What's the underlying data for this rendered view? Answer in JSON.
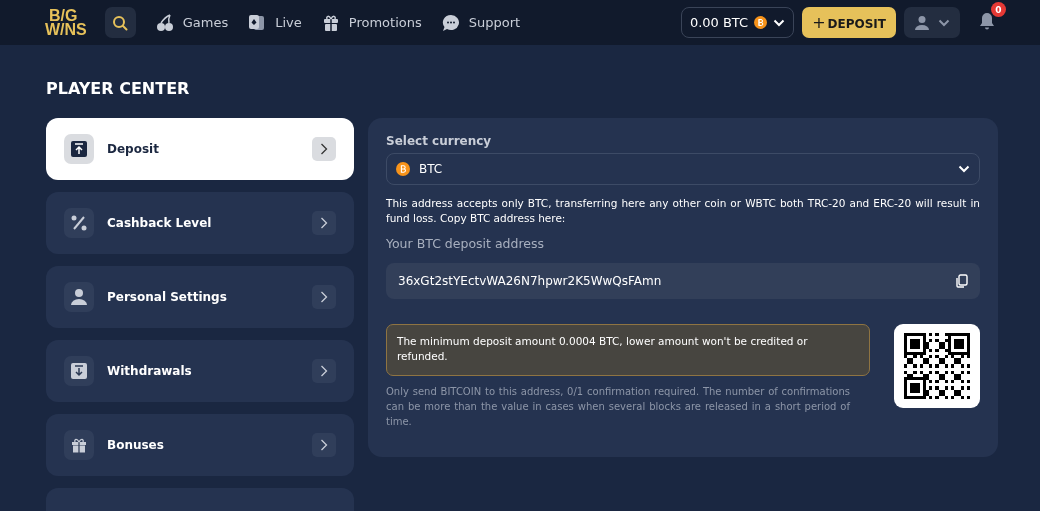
{
  "logo": {
    "line_1": "B/G",
    "line_2": "W/NS"
  },
  "nav": [
    {
      "label": "Games"
    },
    {
      "label": "Live"
    },
    {
      "label": "Promotions"
    },
    {
      "label": "Support"
    }
  ],
  "balance": {
    "amount": "0.00 BTC"
  },
  "deposit_button": {
    "icon": "+",
    "label": "DEPOSIT"
  },
  "notifications": {
    "count": "0"
  },
  "page_title": "PLAYER CENTER",
  "sidebar": {
    "items": [
      {
        "label": "Deposit",
        "selected": true
      },
      {
        "label": "Cashback Level",
        "selected": false
      },
      {
        "label": "Personal Settings",
        "selected": false
      },
      {
        "label": "Withdrawals",
        "selected": false
      },
      {
        "label": "Bonuses",
        "selected": false
      }
    ]
  },
  "deposit": {
    "currency_label": "Select currency",
    "currency": "BTC",
    "warning": "This address accepts only BTC, transferring here any other coin or WBTC both TRC-20 and ERC-20 will result in fund loss. Copy BTC address here:",
    "address_label": "Your BTC deposit address",
    "address": "36xGt2stYEctvWA26N7hpwr2K5WwQsFAmn",
    "minimum_notice": "The minimum deposit amount 0.0004 BTC, lower amount won't be credited or refunded.",
    "info": "Only send BITCOIN to this address, 0/1 confirmation required. The number of confirmations can be more than the value in cases when several blocks are released in a short period of time."
  }
}
